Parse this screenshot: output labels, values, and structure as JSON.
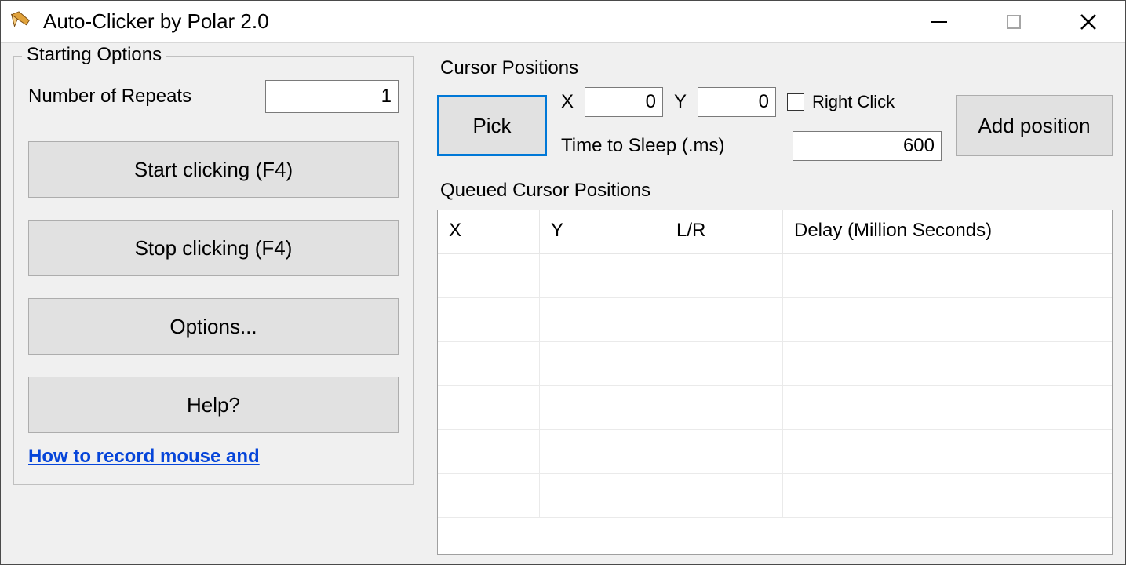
{
  "title": "Auto-Clicker by Polar 2.0",
  "starting_options": {
    "legend": "Starting Options",
    "repeats_label": "Number of Repeats",
    "repeats_value": "1",
    "start_label": "Start clicking (F4)",
    "stop_label": "Stop clicking (F4)",
    "options_label": "Options...",
    "help_label": "Help?",
    "link_text": "How to record mouse and"
  },
  "cursor": {
    "section_label": "Cursor Positions",
    "pick_label": "Pick",
    "x_label": "X",
    "x_value": "0",
    "y_label": "Y",
    "y_value": "0",
    "right_click_label": "Right Click",
    "sleep_label": "Time to Sleep (.ms)",
    "sleep_value": "600",
    "add_label": "Add position"
  },
  "queue": {
    "label": "Queued Cursor Positions",
    "columns": {
      "x": "X",
      "y": "Y",
      "lr": "L/R",
      "delay": "Delay (Million Seconds)"
    }
  }
}
